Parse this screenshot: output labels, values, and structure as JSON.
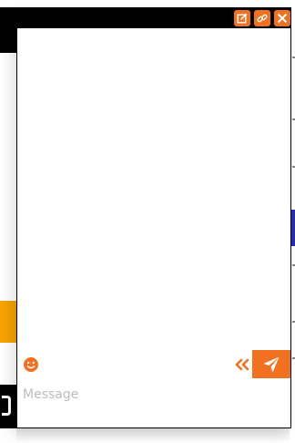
{
  "chat": {
    "composer": {
      "placeholder": "Message"
    },
    "icons": {
      "titlebar": [
        "edit-icon",
        "link-icon",
        "close-icon"
      ],
      "composer": [
        "emoji-icon",
        "collapse-icon",
        "send-icon"
      ]
    }
  },
  "colors": {
    "accent": "#f27121",
    "titlebar": "#000000",
    "background_orange": "#f7a300"
  }
}
